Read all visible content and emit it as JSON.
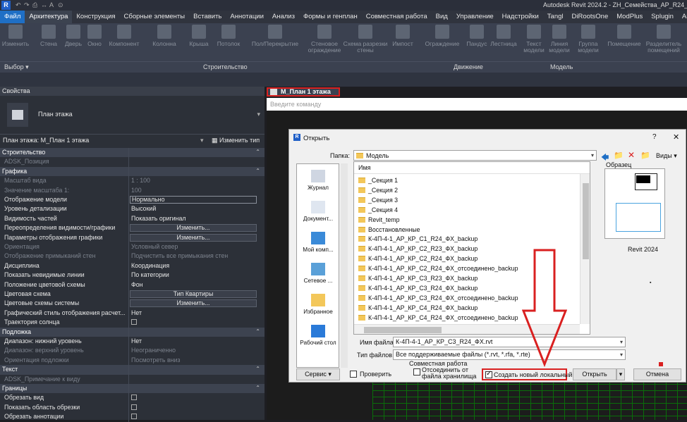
{
  "app": {
    "logo": "R",
    "title": "Autodesk Revit 2024.2 - ZH_Семейства_АР_R24_Ост",
    "quick_access": [
      "↶",
      "↷",
      "⎙",
      "↔",
      "A",
      "⊙"
    ]
  },
  "menu": {
    "tabs": [
      "Файл",
      "Архитектура",
      "Конструкция",
      "Сборные элементы",
      "Вставить",
      "Аннотации",
      "Анализ",
      "Формы и генплан",
      "Совместная работа",
      "Вид",
      "Управление",
      "Надстройки",
      "Tangl",
      "DiRootsOne",
      "ModPlus",
      "Splugin",
      "Archi"
    ],
    "active": "Архитектура"
  },
  "ribbon": {
    "buttons": [
      "Изменить",
      "Стена",
      "Дверь",
      "Окно",
      "Компонент",
      "Колонна",
      "Крыша",
      "Потолок",
      "Пол/Перекрытие",
      "Стеновое ограждение",
      "Схема разрезки стены",
      "Импост",
      "Ограждение",
      "Пандус",
      "Лестница",
      "Текст модели",
      "Линия модели",
      "Группа модели",
      "Помещение",
      "Разделитель помещений"
    ],
    "groups": [
      "Выбор ▾",
      "Строительство",
      "Движение",
      "Модель"
    ]
  },
  "properties": {
    "header": "Свойства",
    "type_name": "План этажа",
    "instance_selector": "План этажа: М_План 1 этажа",
    "edit_type": "Изменить тип",
    "rows": [
      {
        "cat": true,
        "k": "Строительство"
      },
      {
        "k": "ADSK_Позиция",
        "v": "",
        "dim": true
      },
      {
        "cat": true,
        "k": "Графика"
      },
      {
        "k": "Масштаб вида",
        "v": "1 : 100",
        "dim": true
      },
      {
        "k": "Значение масштаба    1:",
        "v": "100",
        "dim": true
      },
      {
        "k": "Отображение модели",
        "v": "Нормально",
        "box": true
      },
      {
        "k": "Уровень детализации",
        "v": "Высокий"
      },
      {
        "k": "Видимость частей",
        "v": "Показать оригинал"
      },
      {
        "k": "Переопределения видимости/графики",
        "v": "Изменить...",
        "btn": true
      },
      {
        "k": "Параметры отображения графики",
        "v": "Изменить...",
        "btn": true
      },
      {
        "k": "Ориентация",
        "v": "Условный север",
        "dim": true
      },
      {
        "k": "Отображение примыканий стен",
        "v": "Подчистить все примыкания стен",
        "dim": true
      },
      {
        "k": "Дисциплина",
        "v": "Координация"
      },
      {
        "k": "Показать невидимые линии",
        "v": "По категории"
      },
      {
        "k": "Положение цветовой схемы",
        "v": "Фон"
      },
      {
        "k": "Цветовая схема",
        "v": "Тип Квартиры",
        "btn": true
      },
      {
        "k": "Цветовые схемы системы",
        "v": "Изменить...",
        "btn": true
      },
      {
        "k": "Графический стиль отображения расчет...",
        "v": "Нет"
      },
      {
        "k": "Траектория солнца",
        "check": true
      },
      {
        "cat": true,
        "k": "Подложка"
      },
      {
        "k": "Диапазон: нижний уровень",
        "v": "Нет"
      },
      {
        "k": "Диапазон: верхний уровень",
        "v": "Неограниченно",
        "dim": true
      },
      {
        "k": "Ориентация подложки",
        "v": "Посмотреть вниз",
        "dim": true
      },
      {
        "cat": true,
        "k": "Текст"
      },
      {
        "k": "ADSK_Примечание к виду",
        "v": "",
        "dim": true
      },
      {
        "cat": true,
        "k": "Границы"
      },
      {
        "k": "Обрезать вид",
        "check": true
      },
      {
        "k": "Показать область обрезки",
        "check": true
      },
      {
        "k": "Обрезать аннотации",
        "check": true
      }
    ]
  },
  "view": {
    "tab": "М_План 1 этажа",
    "command_placeholder": "Введите команду"
  },
  "dialog": {
    "title": "Открыть",
    "folder_label": "Папка:",
    "folder": "Модель",
    "views_label": "Виды",
    "preview_label": "Образец",
    "preview_version": "Revit 2024",
    "places": [
      "Журнал",
      "Документ...",
      "Мой комп...",
      "Сетевое ...",
      "Избранное",
      "Рабочий стол"
    ],
    "column_name": "Имя",
    "files": [
      "_Секция 1",
      "_Секция 2",
      "_Секция 3",
      "_Секция 4",
      "Revit_temp",
      "Восстановленные",
      "К-4П-4-1_АР_КР_С1_R24_ФХ_backup",
      "К-4П-4-1_АР_КР_С2_R23_ФХ_backup",
      "К-4П-4-1_АР_КР_С2_R24_ФХ_backup",
      "К-4П-4-1_АР_КР_С2_R24_ФХ_отсоединено_backup",
      "К-4П-4-1_АР_КР_С3_R23_ФХ_backup",
      "К-4П-4-1_АР_КР_С3_R24_ФХ_backup",
      "К-4П-4-1_АР_КР_С3_R24_ФХ_отсоединено_backup",
      "К-4П-4-1_АР_КР_С4_R24_ФХ_backup",
      "К-4П-4-1_АР_КР_С4_R24_ФХ_отсоединено_backup"
    ],
    "filename_label": "Имя файла:",
    "filename": "К-4П-4-1_АР_КР_С3_R24_ФХ.rvt",
    "filetype_label": "Тип файлов:",
    "filetype": "Все поддерживаемые файлы  (*.rvt, *.rfa, *.rte)",
    "service": "Сервис",
    "verify": "Проверить",
    "worksharing_label": "Совместная работа",
    "detach": "Отсоединить от файла хранилища",
    "create_local": "Создать новый локальный",
    "open": "Открыть",
    "cancel": "Отмена"
  },
  "colors": {
    "accent": "#1f6fc5",
    "highlight": "#d92020",
    "canvas_lines": "#0a6e0a"
  }
}
